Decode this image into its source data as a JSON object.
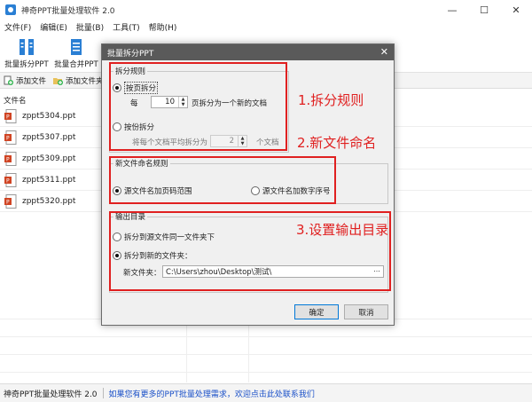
{
  "window": {
    "title": "神奇PPT批量处理软件 2.0",
    "min": "—",
    "max": "☐",
    "close": "✕"
  },
  "menu": [
    "文件(F)",
    "编辑(E)",
    "批量(B)",
    "工具(T)",
    "帮助(H)"
  ],
  "toolbar": {
    "split_label": "批量拆分PPT",
    "merge_label": "批量合并PPT"
  },
  "subbar": {
    "add_file": "添加文件",
    "add_folder": "添加文件夹"
  },
  "filelist": {
    "header": "文件名",
    "files": [
      "zppt5304.ppt",
      "zppt5307.ppt",
      "zppt5309.ppt",
      "zppt5311.ppt",
      "zppt5320.ppt"
    ]
  },
  "statusbar": {
    "app_name": "神奇PPT批量处理软件 2.0",
    "link": "如果您有更多的PPT批量处理需求，欢迎点击此处联系我们"
  },
  "dialog": {
    "title": "批量拆分PPT",
    "close": "✕",
    "split_rule": {
      "legend": "拆分规则",
      "by_page_label": "按页拆分",
      "by_page_checked": true,
      "each_label": "每",
      "pages_value": "10",
      "pages_suffix": "页拆分为一个新的文档",
      "by_count_label": "按份拆分",
      "by_count_checked": false,
      "count_prefix": "将每个文档平均拆分为",
      "count_value": "2",
      "count_suffix": "个文档"
    },
    "naming": {
      "legend": "新文件命名规则",
      "opt_range": "源文件名加页码范围",
      "opt_range_checked": true,
      "opt_seq": "源文件名加数字序号",
      "opt_seq_checked": false
    },
    "output": {
      "legend": "输出目录",
      "opt_same": "拆分到源文件同一文件夹下",
      "opt_same_checked": false,
      "opt_new": "拆分到新的文件夹：",
      "opt_new_checked": true,
      "new_folder_label": "新文件夹：",
      "path_value": "C:\\Users\\zhou\\Desktop\\测试\\",
      "browse": "..."
    },
    "ok_label": "确定",
    "cancel_label": "取消"
  },
  "annotations": {
    "a1": "1.拆分规则",
    "a2": "2.新文件命名",
    "a3": "3.设置输出目录"
  },
  "colors": {
    "annotation_red": "#e02020",
    "accent_blue": "#2a7fd4",
    "link_blue": "#1a50c8"
  }
}
